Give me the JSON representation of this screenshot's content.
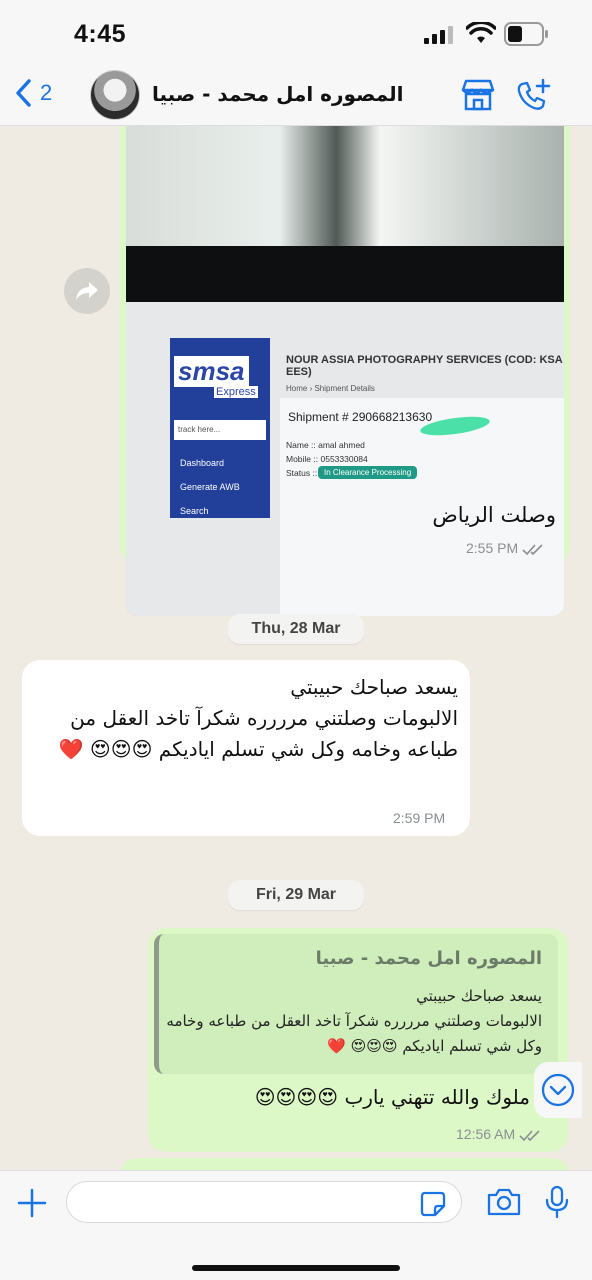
{
  "status_bar": {
    "time": "4:45"
  },
  "header": {
    "back_count": "2",
    "contact_name": "المصوره امل محمد - صبيا"
  },
  "image_screen": {
    "company": "NOUR ASSIA PHOTOGRAPHY SERVICES (COD: KSA EES)",
    "breadcrumb_home": "Home",
    "breadcrumb_page": "Shipment Details",
    "logo": "smsa",
    "logo_sub": "Express",
    "search_placeholder": "track here...",
    "menu": [
      "Dashboard",
      "Generate AWB",
      "Search"
    ],
    "shipment_label": "Shipment # 290668213630",
    "name_line": "Name :: amal ahmed",
    "mobile_line": "Mobile :: 0553330084",
    "status_label": "Status ::",
    "status_value": "In Clearance Processing"
  },
  "messages": [
    {
      "direction": "out",
      "text": "وصلت الرياض",
      "time": "2:55 PM"
    },
    {
      "direction": "in",
      "text": "يسعد صباحك حبيبتي\nالالبومات وصلتني مرررره شكرآ تاخد العقل من طباعه وخامه وكل شي تسلم اياديكم 😍😍😍 ❤️",
      "time": "2:59 PM"
    },
    {
      "direction": "out",
      "quote_name": "المصوره امل محمد - صبيا",
      "quote_text": "يسعد صباحك حبيبتي\nالالبومات وصلتني مرررره شكرآ تاخد العقل من طباعه وخامه وكل شي تسلم اياديكم 😍😍😍 ❤️",
      "text": "ملوك والله تتهني يارب 😍😍😍😍",
      "time": "12:56 AM"
    }
  ],
  "dates": [
    "Thu, 28 Mar",
    "Fri, 29 Mar"
  ],
  "composer": {
    "placeholder": ""
  },
  "icons": {
    "back": "chevron-left-icon",
    "store": "store-icon",
    "call_add": "phone-add-icon",
    "forward": "forward-icon",
    "plus": "plus-icon",
    "sticker": "sticker-icon",
    "camera": "camera-icon",
    "mic": "mic-icon",
    "scroll_down": "chevron-down-icon"
  },
  "colors": {
    "outgoing_bubble": "#dcf8c6",
    "incoming_bubble": "#ffffff",
    "accent": "#1b74e4",
    "chat_background": "#efeae2"
  }
}
